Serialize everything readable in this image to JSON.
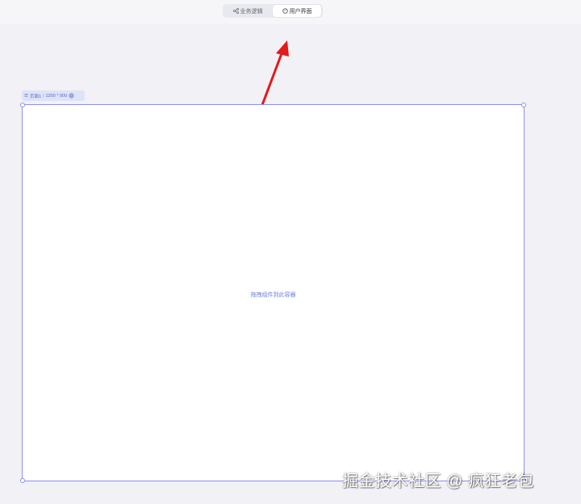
{
  "tabs": {
    "logic_label": "业务逻辑",
    "ui_label": "用户界面"
  },
  "page_tag": {
    "name": "页面1",
    "size": "1200 * 900"
  },
  "canvas": {
    "placeholder": "拖拽组件到此容器"
  },
  "annotation": {
    "color": "#e31b1b"
  },
  "watermark": "掘金技术社区 @ 疯狂老包",
  "colors": {
    "accent": "#8f8ff5",
    "hint": "#6e7fe0",
    "background": "#f1f1f6"
  }
}
